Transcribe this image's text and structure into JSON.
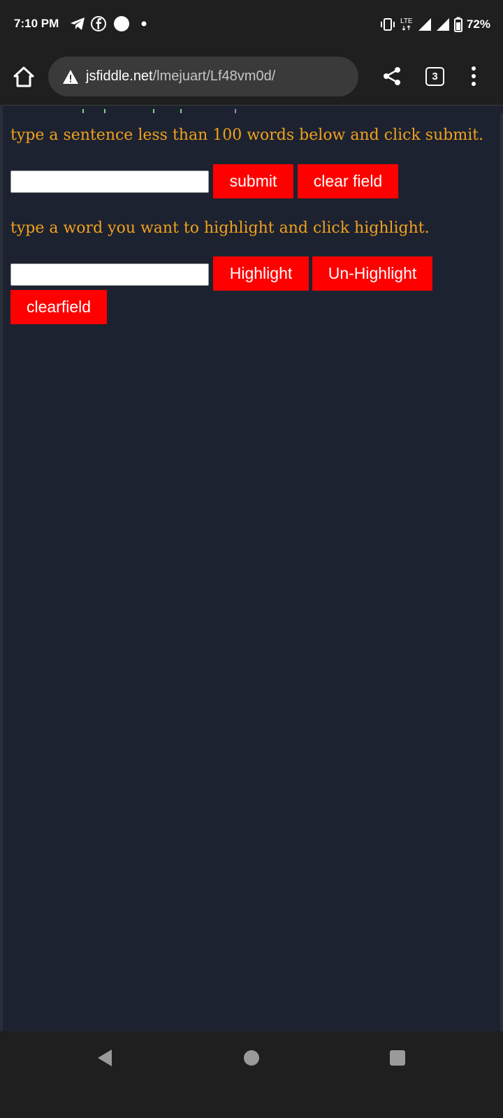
{
  "status_bar": {
    "time": "7:10 PM",
    "notification_icons": [
      "telegram-icon",
      "facebook-icon",
      "circle-app-icon",
      "dot-icon"
    ],
    "network": "LTE",
    "battery": "72%"
  },
  "browser": {
    "url_domain": "jsfiddle.net",
    "url_path": "/lmejuart/Lf48vm0d/",
    "tab_count": "3"
  },
  "page": {
    "prompt_submit": "type a sentence less than 100 words below and click submit.",
    "submit_label": "submit",
    "clear_field_label": "clear field",
    "prompt_highlight": "type a word you want to highlight and click highlight.",
    "highlight_label": "Highlight",
    "unhighlight_label": "Un-Highlight",
    "clearfield_label": "clearfield",
    "sentence_input_value": "",
    "word_input_value": ""
  },
  "colors": {
    "accent_text": "#f0a21d",
    "button_bg": "#ff0000",
    "page_bg": "#1d2230"
  }
}
